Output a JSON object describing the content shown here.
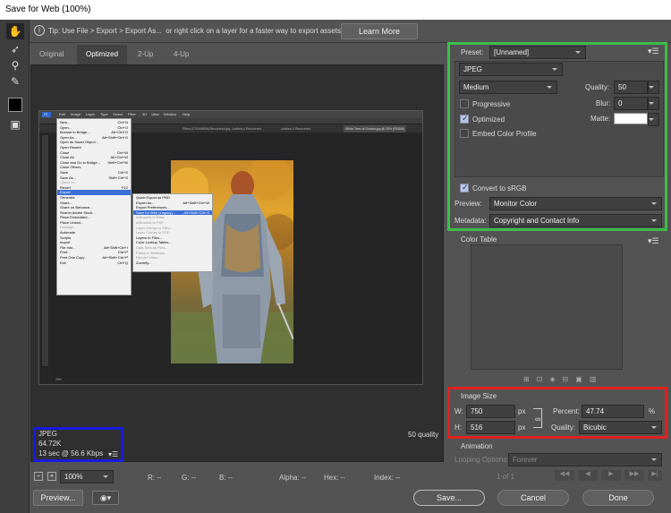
{
  "window": {
    "title": "Save for Web (100%)"
  },
  "tip": {
    "text": "Tip: Use File > Export > Export As...  or right click on a layer for a faster way to export assets",
    "learn_more": "Learn More"
  },
  "tabs": [
    "Original",
    "Optimized",
    "2-Up",
    "4-Up"
  ],
  "preview": {
    "ps_menubar": [
      "Fil",
      "Edit",
      "Image",
      "Layer",
      "Type",
      "Select",
      "Filter",
      "3D",
      "View",
      "Window",
      "Help"
    ],
    "ps_tabs": [
      "Effect-4721698596-Recovered.jpg",
      "Untitled-4 Recovered",
      "Untitled-4 Recovered",
      "White-Tree-of-Gondor.jpg @ 25% (RGB/8)"
    ],
    "file_menu": [
      "New...",
      "Open...",
      "Browse in Bridge...",
      "Open As...",
      "Open as Smart Object...",
      "Open Recent",
      "Close",
      "Close All",
      "Close and Go to Bridge...",
      "Close Others",
      "Save",
      "Save As...",
      "Check In...",
      "Revert",
      "Export",
      "Generate",
      "Share...",
      "Share on Behance...",
      "Search Adobe Stock...",
      "Place Embedded...",
      "Place Linked...",
      "Package...",
      "Automate",
      "Scripts",
      "Import",
      "File Info...",
      "Print...",
      "Print One Copy",
      "Exit"
    ],
    "file_shortcuts": [
      "Ctrl+N",
      "Ctrl+O",
      "Alt+Ctrl+O",
      "Alt+Shift+Ctrl+O",
      "",
      "",
      "Ctrl+W",
      "Alt+Ctrl+W",
      "Shift+Ctrl+W",
      "",
      "Ctrl+S",
      "Shift+Ctrl+S",
      "",
      "F12",
      "",
      "",
      "",
      "",
      "",
      "",
      "",
      "",
      "",
      "",
      "",
      "Alt+Shift+Ctrl+I",
      "Ctrl+P",
      "Alt+Shift+Ctrl+P",
      "Ctrl+Q"
    ],
    "export_menu": [
      "Quick Export as PNG",
      "Export As...",
      "Export Preferences...",
      "Save for Web (Legacy)...",
      "Artboards to Files...",
      "Artboards to PDF...",
      "Layer Comps to Files...",
      "Layer Comps to PDF...",
      "Layers to Files...",
      "Color Lookup Tables...",
      "Data Sets as Files...",
      "Paths to Illustrator...",
      "Render Video...",
      "Zoomify..."
    ],
    "export_shortcuts": [
      "",
      "Alt+Shift+Ctrl+W",
      "",
      "Alt+Shift+Ctrl+S",
      "",
      "",
      "",
      "",
      "",
      "",
      "",
      "",
      "",
      ""
    ],
    "ps_status": "25%",
    "info_box": {
      "format": "JPEG",
      "size": "64.72K",
      "time": "13 sec @ 56.6 Kbps"
    },
    "quality_note": "50 quality"
  },
  "settings": {
    "preset_label": "Preset:",
    "preset_value": "[Unnamed]",
    "format": "JPEG",
    "quality_level": "Medium",
    "quality_label": "Quality:",
    "quality_value": "50",
    "progressive": "Progressive",
    "blur_label": "Blur:",
    "blur_value": "0",
    "optimized": "Optimized",
    "matte_label": "Matte:",
    "embed_profile": "Embed Color Profile",
    "convert_srgb": "Convert to sRGB",
    "preview_label": "Preview:",
    "preview_value": "Monitor Color",
    "metadata_label": "Metadata:",
    "metadata_value": "Copyright and Contact Info",
    "checks": {
      "progressive": false,
      "optimized": true,
      "embed_profile": false,
      "convert_srgb": true
    }
  },
  "color_table": {
    "title": "Color Table"
  },
  "image_size": {
    "title": "Image Size",
    "w_label": "W:",
    "w_value": "750",
    "h_label": "H:",
    "h_value": "516",
    "unit": "px",
    "percent_label": "Percent:",
    "percent_value": "47.74",
    "percent_unit": "%",
    "quality_label": "Quality:",
    "quality_value": "Bicubic"
  },
  "animation": {
    "title": "Animation",
    "looping_label": "Looping Options:",
    "looping_value": "Forever",
    "frame": "1 of 1"
  },
  "statusbar": {
    "zoom": "100%",
    "r": "R: --",
    "g": "G: --",
    "b": "B: --",
    "alpha": "Alpha: --",
    "hex": "Hex: --",
    "index": "Index: --"
  },
  "bottom": {
    "preview_btn": "Preview...",
    "save_btn": "Save...",
    "cancel_btn": "Cancel",
    "done_btn": "Done"
  },
  "colors": {
    "green_highlight": "#3dbd4a",
    "red_highlight": "#e02020",
    "blue_highlight": "#1a1ae0",
    "menu_highlight": "#3a6fd8"
  }
}
